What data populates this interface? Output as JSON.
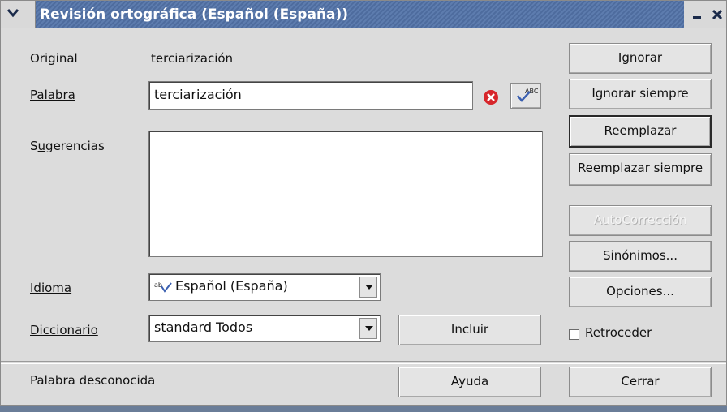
{
  "title": "Revisión ortográfica (Español (España))",
  "labels": {
    "original": "Original",
    "original_value": "terciarización",
    "palabra": "Palabra",
    "sugerencias": "Sugerencias",
    "idioma": "Idioma",
    "diccionario": "Diccionario",
    "status": "Palabra desconocida"
  },
  "palabra_value": "terciarización",
  "idioma_value": "Español (España)",
  "diccionario_value": "standard Todos",
  "buttons": {
    "ignorar": "Ignorar",
    "ignorar_siempre": "Ignorar siempre",
    "reemplazar": "Reemplazar",
    "reemplazar_siempre": "Reemplazar siempre",
    "autocorreccion": "AutoCorrección",
    "sinonimos": "Sinónimos...",
    "opciones": "Opciones...",
    "incluir": "Incluir",
    "ayuda": "Ayuda",
    "cerrar": "Cerrar"
  },
  "retroceder_label": "Retroceder",
  "retroceder_checked": false,
  "icons": {
    "menu": "chevron-down-icon",
    "minimize": "minimize-icon",
    "close": "close-icon",
    "error": "error-icon",
    "spellcheck": "spellcheck-icon",
    "language": "language-icon"
  },
  "colors": {
    "titlebar": "#5d7cae",
    "error": "#d7262b"
  }
}
